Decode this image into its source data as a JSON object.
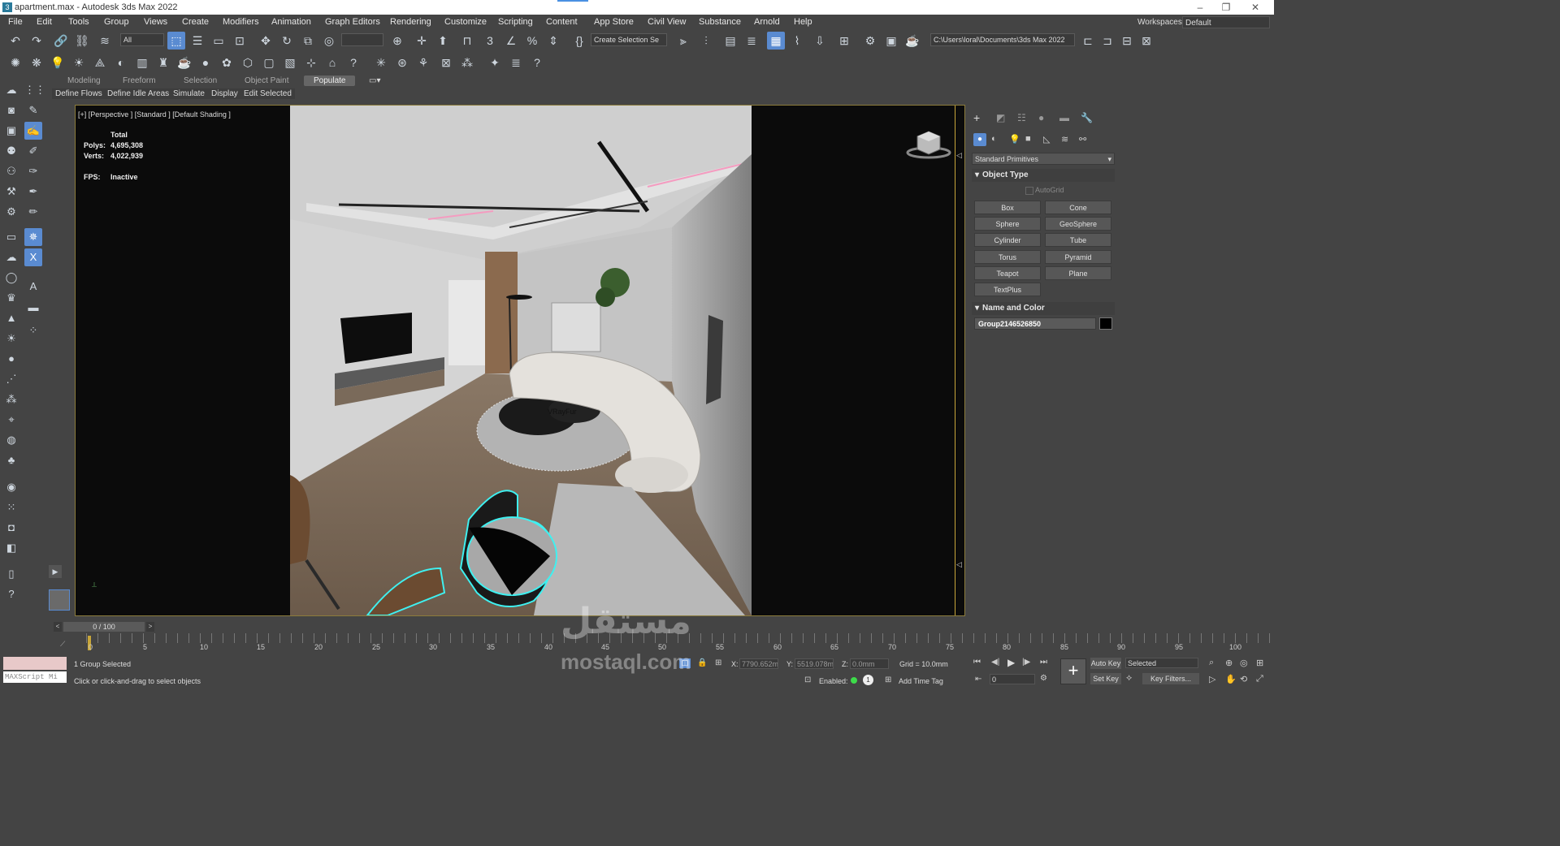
{
  "window": {
    "title": "apartment.max - Autodesk 3ds Max 2022",
    "controls": [
      "–",
      "❐",
      "✕"
    ]
  },
  "menu": [
    "File",
    "Edit",
    "Tools",
    "Group",
    "Views",
    "Create",
    "Modifiers",
    "Animation",
    "Graph Editors",
    "Rendering",
    "Customize",
    "Scripting",
    "Content",
    "App Store",
    "Civil View",
    "Substance",
    "Arnold",
    "Help"
  ],
  "workspace": {
    "label": "Workspaces:",
    "value": "Default"
  },
  "toolbar": {
    "selection_filter": "All",
    "named_selection": "Create Selection Se",
    "project_path": "C:\\Users\\loral\\Documents\\3ds Max 2022"
  },
  "ribbon": {
    "tabs": [
      "Modeling",
      "Freeform",
      "Selection",
      "Object Paint",
      "Populate"
    ],
    "active_tab": "Populate",
    "buttons": [
      "Define Flows",
      "Define Idle Areas",
      "Simulate",
      "Display",
      "Edit Selected"
    ]
  },
  "viewport": {
    "label": "[+] [Perspective ] [Standard ] [Default Shading ]",
    "stats_total": "Total",
    "polys_label": "Polys:",
    "polys_value": "4,695,308",
    "verts_label": "Verts:",
    "verts_value": "4,022,939",
    "fps_label": "FPS:",
    "fps_value": "Inactive",
    "object_label": "VRayFur"
  },
  "command_panel": {
    "dropdown": "Standard Primitives",
    "object_type_title": "Object Type",
    "autogrid": "AutoGrid",
    "primitives": [
      "Box",
      "Cone",
      "Sphere",
      "GeoSphere",
      "Cylinder",
      "Tube",
      "Torus",
      "Pyramid",
      "Teapot",
      "Plane",
      "TextPlus"
    ],
    "name_color_title": "Name and Color",
    "object_name": "Group2146526850",
    "object_color": "#000000"
  },
  "timeline": {
    "frame_counter": "0 / 100",
    "ticks": [
      "0",
      "5",
      "10",
      "15",
      "20",
      "25",
      "30",
      "35",
      "40",
      "45",
      "50",
      "55",
      "60",
      "65",
      "70",
      "75",
      "80",
      "85",
      "90",
      "95",
      "100"
    ]
  },
  "status": {
    "maxscript": "MAXScript Mi",
    "selection": "1 Group Selected",
    "prompt": "Click or click-and-drag to select objects",
    "x_label": "X:",
    "x_value": "7790.652m",
    "y_label": "Y:",
    "y_value": "5519.078m",
    "z_label": "Z:",
    "z_value": "0.0mm",
    "grid": "Grid = 10.0mm",
    "enabled": "Enabled:",
    "add_time_tag": "Add Time Tag",
    "auto_key": "Auto Key",
    "set_key": "Set Key",
    "key_mode": "Selected",
    "key_filters": "Key Filters...",
    "current_frame": "0"
  },
  "watermark": {
    "arabic": "مستقل",
    "latin": "mostaql.com"
  }
}
